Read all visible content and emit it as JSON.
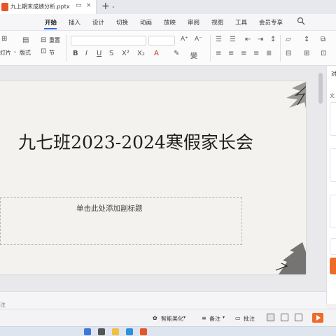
{
  "tabbar": {
    "file_name": "九上期末成绩分析.pptx",
    "plus": "+",
    "plus_caret": "⌄"
  },
  "menubar": {
    "items": [
      "开始",
      "插入",
      "设计",
      "切换",
      "动画",
      "放映",
      "审阅",
      "视图",
      "工具",
      "会员专享"
    ],
    "active_index": 0
  },
  "ribbon": {
    "new_slide": "重置",
    "layout_label": "灯片",
    "layout_caret": "⌄",
    "format_label": "版式",
    "section_label": "节"
  },
  "slide": {
    "title": "九七班2023-2024寒假家长会",
    "subtitle_placeholder": "单击此处添加副标题"
  },
  "right_panel": {
    "label": "对",
    "label2": "文"
  },
  "notes": {
    "placeholder": "注"
  },
  "statusbar": {
    "smart_beautify": "智能美化",
    "remarks": "备注",
    "comments": "批注"
  },
  "colors": {
    "accent_blue": "#2f6bde",
    "wps_orange": "#f06a28",
    "slide_bg": "#f4f2ee"
  }
}
